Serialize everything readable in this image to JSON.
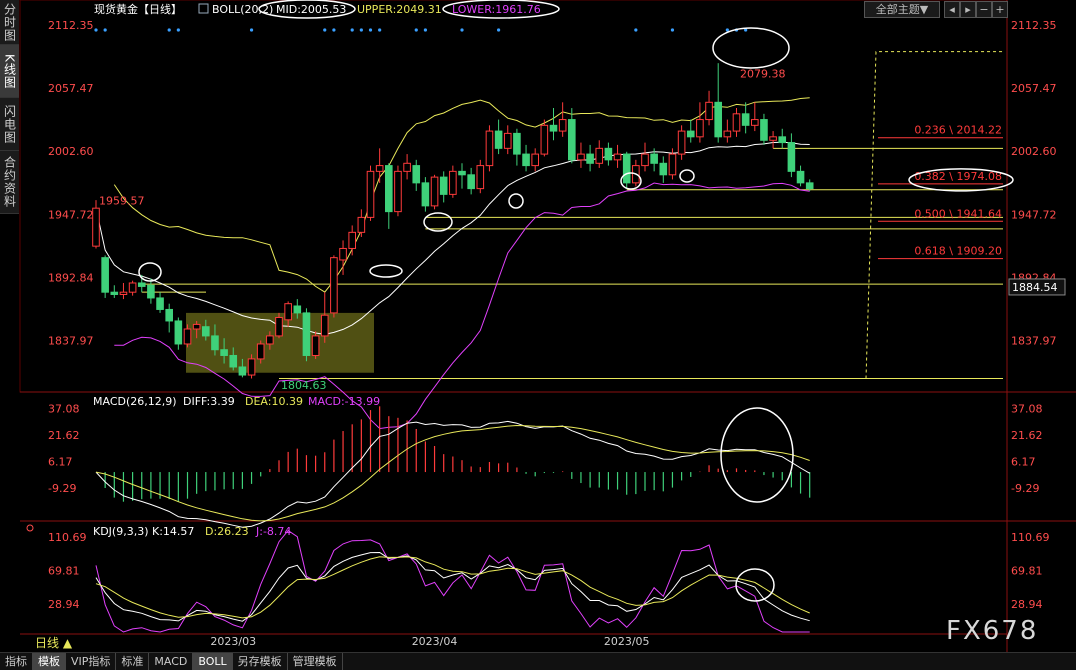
{
  "header": {
    "title": "现货黄金【日线】",
    "boll_prefix": "BOLL(20,2)",
    "mid_label": "MID:2005.53",
    "upper_label": "UPPER:2049.31",
    "lower_label": "LOWER:1961.76",
    "theme_button": "全部主题▼"
  },
  "side_tabs": [
    {
      "label": "分时图",
      "active": false
    },
    {
      "label": "K线图",
      "active": true
    },
    {
      "label": "闪电图",
      "active": false
    },
    {
      "label": "合约资料",
      "active": false
    }
  ],
  "bottom_tabs": [
    {
      "label": "指标",
      "active": false
    },
    {
      "label": "模板",
      "active": true
    },
    {
      "label": "VIP指标",
      "active": false
    },
    {
      "label": "标准",
      "active": false
    },
    {
      "label": "MACD",
      "active": false
    },
    {
      "label": "BOLL",
      "active": true
    },
    {
      "label": "另存模板",
      "active": false
    },
    {
      "label": "管理模板",
      "active": false
    }
  ],
  "period_label": "日线 ▲",
  "watermark": "FX678",
  "colors": {
    "up": "#ff3b3b",
    "down": "#3fd17a",
    "boll_mid": "#ffffff",
    "boll_upper": "#e8e85a",
    "boll_lower": "#e040fb",
    "macd_diff": "#ffffff",
    "macd_dea": "#e8e85a",
    "kdj_k": "#ffffff",
    "kdj_d": "#e8e85a",
    "kdj_j": "#e040fb",
    "axis_label": "#ff4d4d",
    "fib": "#ff3b3b",
    "box": "#6b6b1a"
  },
  "chart_data": [
    {
      "type": "candlestick",
      "title": "现货黄金【日线】",
      "ylim": [
        1795,
        2120
      ],
      "y_ticks": [
        "2112.35",
        "2057.47",
        "2002.60",
        "1947.72",
        "1892.84",
        "1837.97"
      ],
      "x_ticks": [
        {
          "i": 15,
          "label": "2023/03"
        },
        {
          "i": 37,
          "label": "2023/04"
        },
        {
          "i": 58,
          "label": "2023/05"
        }
      ],
      "current_price_label": "1884.54",
      "current_price": 1884.54,
      "annotations": {
        "high_label": "2079.38",
        "low_label": "1804.63",
        "start_label": "1959.57"
      },
      "fibonacci": [
        {
          "label": "0.236 \\ 2014.22",
          "value": 2014.22
        },
        {
          "label": "0.382 \\ 1974.08",
          "value": 1974.08
        },
        {
          "label": "0.500 \\ 1941.64",
          "value": 1941.64
        },
        {
          "label": "0.618 \\ 1909.20",
          "value": 1909.2
        }
      ],
      "horizontal_levels": [
        2005,
        1969,
        1945,
        1935,
        1887,
        1805
      ],
      "candles": [
        [
          1920,
          1953,
          1960,
          1918
        ],
        [
          1910,
          1880,
          1912,
          1875
        ],
        [
          1880,
          1878,
          1886,
          1875
        ],
        [
          1878,
          1880,
          1888,
          1874
        ],
        [
          1880,
          1888,
          1890,
          1877
        ],
        [
          1888,
          1885,
          1895,
          1880
        ],
        [
          1886,
          1875,
          1892,
          1870
        ],
        [
          1875,
          1865,
          1880,
          1862
        ],
        [
          1865,
          1855,
          1870,
          1845
        ],
        [
          1855,
          1835,
          1858,
          1830
        ],
        [
          1835,
          1848,
          1852,
          1832
        ],
        [
          1848,
          1852,
          1855,
          1840
        ],
        [
          1850,
          1842,
          1856,
          1838
        ],
        [
          1842,
          1830,
          1852,
          1825
        ],
        [
          1830,
          1825,
          1840,
          1818
        ],
        [
          1825,
          1815,
          1832,
          1812
        ],
        [
          1815,
          1808,
          1822,
          1806
        ],
        [
          1808,
          1822,
          1826,
          1805
        ],
        [
          1822,
          1835,
          1838,
          1818
        ],
        [
          1835,
          1842,
          1846,
          1830
        ],
        [
          1842,
          1858,
          1862,
          1840
        ],
        [
          1856,
          1870,
          1872,
          1850
        ],
        [
          1868,
          1862,
          1874,
          1857
        ],
        [
          1862,
          1825,
          1866,
          1820
        ],
        [
          1825,
          1842,
          1846,
          1822
        ],
        [
          1842,
          1860,
          1880,
          1836
        ],
        [
          1862,
          1910,
          1912,
          1858
        ],
        [
          1908,
          1918,
          1925,
          1895
        ],
        [
          1918,
          1932,
          1938,
          1912
        ],
        [
          1932,
          1945,
          1952,
          1928
        ],
        [
          1945,
          1985,
          1990,
          1942
        ],
        [
          1985,
          1990,
          2005,
          1975
        ],
        [
          1990,
          1950,
          1992,
          1935
        ],
        [
          1950,
          1985,
          1990,
          1946
        ],
        [
          1985,
          1992,
          2000,
          1978
        ],
        [
          1990,
          1975,
          1995,
          1968
        ],
        [
          1975,
          1955,
          1980,
          1950
        ],
        [
          1955,
          1980,
          1982,
          1952
        ],
        [
          1980,
          1965,
          1985,
          1958
        ],
        [
          1965,
          1985,
          1990,
          1962
        ],
        [
          1985,
          1982,
          1992,
          1970
        ],
        [
          1982,
          1970,
          1988,
          1965
        ],
        [
          1970,
          1990,
          1995,
          1966
        ],
        [
          1990,
          2020,
          2025,
          1985
        ],
        [
          2020,
          2005,
          2030,
          2000
        ],
        [
          2005,
          2018,
          2025,
          2000
        ],
        [
          2018,
          2000,
          2022,
          1990
        ],
        [
          2000,
          1990,
          2008,
          1985
        ],
        [
          1990,
          2000,
          2005,
          1985
        ],
        [
          2000,
          2025,
          2030,
          1998
        ],
        [
          2025,
          2020,
          2040,
          2012
        ],
        [
          2020,
          2030,
          2045,
          2015
        ],
        [
          2030,
          1995,
          2040,
          1992
        ],
        [
          1995,
          2000,
          2010,
          1988
        ],
        [
          2000,
          1992,
          2008,
          1985
        ],
        [
          1992,
          2005,
          2012,
          1988
        ],
        [
          2005,
          1995,
          2010,
          1990
        ],
        [
          1995,
          2000,
          2008,
          1988
        ],
        [
          2000,
          1975,
          2002,
          1970
        ],
        [
          1975,
          1990,
          1995,
          1972
        ],
        [
          1990,
          2000,
          2010,
          1985
        ],
        [
          2000,
          1992,
          2005,
          1985
        ],
        [
          1992,
          1982,
          1998,
          1975
        ],
        [
          1982,
          2000,
          2005,
          1978
        ],
        [
          2000,
          2020,
          2025,
          1995
        ],
        [
          2020,
          2015,
          2030,
          2010
        ],
        [
          2015,
          2030,
          2045,
          2010
        ],
        [
          2030,
          2045,
          2055,
          2025
        ],
        [
          2045,
          2015,
          2079,
          2010
        ],
        [
          2015,
          2020,
          2030,
          2010
        ],
        [
          2020,
          2035,
          2040,
          2015
        ],
        [
          2035,
          2025,
          2045,
          2018
        ],
        [
          2025,
          2030,
          2045,
          2020
        ],
        [
          2030,
          2012,
          2035,
          2008
        ],
        [
          2012,
          2015,
          2020,
          2005
        ],
        [
          2015,
          2010,
          2022,
          2005
        ],
        [
          2010,
          1985,
          2018,
          1980
        ],
        [
          1985,
          1975,
          1990,
          1972
        ],
        [
          1975,
          1970,
          1978,
          1968
        ]
      ]
    },
    {
      "type": "bar_line",
      "title": "MACD(26,12,9)",
      "diff_label": "DIFF:3.39",
      "dea_label": "DEA:10.39",
      "macd_label": "MACD:-13.99",
      "ylim": [
        -28,
        45
      ],
      "y_ticks": [
        "37.08",
        "21.62",
        "6.17",
        "-9.29"
      ],
      "y_tick_values": [
        37.08,
        21.62,
        6.17,
        -9.29
      ]
    },
    {
      "type": "line",
      "title": "KDJ(9,3,3)",
      "k_label": "K:14.57",
      "d_label": "D:26.23",
      "j_label": "J:-8.74",
      "ylim": [
        -5,
        125
      ],
      "y_ticks": [
        "110.69",
        "69.81",
        "28.94"
      ],
      "y_tick_values": [
        110.69,
        69.81,
        28.94
      ]
    }
  ]
}
